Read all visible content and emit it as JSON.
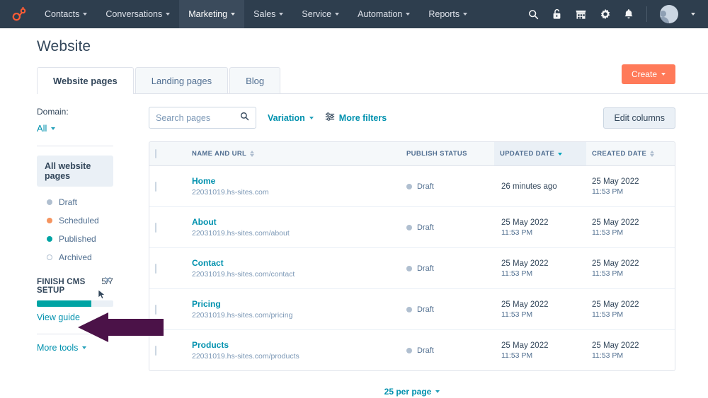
{
  "topnav": {
    "logo_icon": "hubspot-sprocket-logo",
    "items": [
      {
        "label": "Contacts",
        "active": false
      },
      {
        "label": "Conversations",
        "active": false
      },
      {
        "label": "Marketing",
        "active": true
      },
      {
        "label": "Sales",
        "active": false
      },
      {
        "label": "Service",
        "active": false
      },
      {
        "label": "Automation",
        "active": false
      },
      {
        "label": "Reports",
        "active": false
      }
    ],
    "icons": [
      "search-icon",
      "unlock-icon",
      "marketplace-icon",
      "gear-icon",
      "notifications-bell-icon"
    ],
    "avatar_icon": "user-avatar"
  },
  "header": {
    "title": "Website",
    "create_label": "Create",
    "tabs": [
      {
        "label": "Website pages",
        "active": true
      },
      {
        "label": "Landing pages",
        "active": false
      },
      {
        "label": "Blog",
        "active": false
      }
    ]
  },
  "sidebar": {
    "domain_label": "Domain:",
    "domain_value": "All",
    "all_pages_label": "All website pages",
    "statuses": [
      {
        "label": "Draft",
        "color": "#b0bfd0",
        "hollow": false
      },
      {
        "label": "Scheduled",
        "color": "#f5945f",
        "hollow": false
      },
      {
        "label": "Published",
        "color": "#00a4a4",
        "hollow": false
      },
      {
        "label": "Archived",
        "color": "#b0bfd0",
        "hollow": true
      }
    ],
    "setup": {
      "title": "FINISH CMS SETUP",
      "count": "5/7",
      "progress_percent": 71,
      "progress_color": "#00a4a4",
      "view_guide_label": "View guide",
      "close_icon": "close-icon"
    },
    "more_tools_label": "More tools"
  },
  "toolbar": {
    "search_placeholder": "Search pages",
    "search_value": "",
    "search_icon": "search-icon",
    "variation_label": "Variation",
    "more_filters_label": "More filters",
    "filters_icon": "filter-sliders-icon",
    "edit_columns_label": "Edit columns"
  },
  "table": {
    "columns": [
      {
        "label": "NAME AND URL",
        "sortable": true,
        "sorted": false
      },
      {
        "label": "PUBLISH STATUS",
        "sortable": false,
        "sorted": false
      },
      {
        "label": "UPDATED DATE",
        "sortable": true,
        "sorted": true,
        "direction": "desc"
      },
      {
        "label": "CREATED DATE",
        "sortable": true,
        "sorted": false
      }
    ],
    "rows": [
      {
        "name": "Home",
        "url": "22031019.hs-sites.com",
        "status": "Draft",
        "status_color": "#b0bfd0",
        "updated_main": "26 minutes ago",
        "updated_sub": "",
        "created_main": "25 May 2022",
        "created_sub": "11:53 PM"
      },
      {
        "name": "About",
        "url": "22031019.hs-sites.com/about",
        "status": "Draft",
        "status_color": "#b0bfd0",
        "updated_main": "25 May 2022",
        "updated_sub": "11:53 PM",
        "created_main": "25 May 2022",
        "created_sub": "11:53 PM"
      },
      {
        "name": "Contact",
        "url": "22031019.hs-sites.com/contact",
        "status": "Draft",
        "status_color": "#b0bfd0",
        "updated_main": "25 May 2022",
        "updated_sub": "11:53 PM",
        "created_main": "25 May 2022",
        "created_sub": "11:53 PM"
      },
      {
        "name": "Pricing",
        "url": "22031019.hs-sites.com/pricing",
        "status": "Draft",
        "status_color": "#b0bfd0",
        "updated_main": "25 May 2022",
        "updated_sub": "11:53 PM",
        "created_main": "25 May 2022",
        "created_sub": "11:53 PM"
      },
      {
        "name": "Products",
        "url": "22031019.hs-sites.com/products",
        "status": "Draft",
        "status_color": "#b0bfd0",
        "updated_main": "25 May 2022",
        "updated_sub": "11:53 PM",
        "created_main": "25 May 2022",
        "created_sub": "11:53 PM"
      }
    ]
  },
  "footer": {
    "per_page_label": "25 per page"
  },
  "annotation": {
    "arrow_color": "#4b1248",
    "arrow_direction": "left",
    "points_at": "View guide"
  },
  "colors": {
    "nav_bg": "#2e3e4e",
    "accent_orange": "#ff7a59",
    "link_teal": "#0091ae",
    "progress_teal": "#00a4a4"
  }
}
